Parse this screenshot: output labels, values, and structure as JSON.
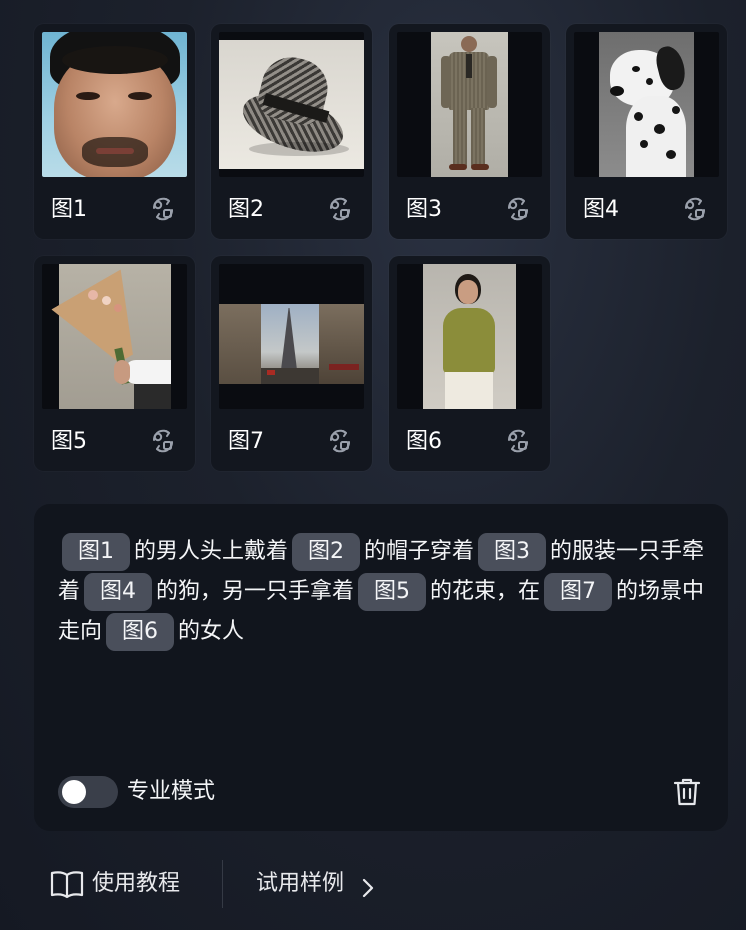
{
  "images": [
    {
      "label": "图1",
      "icon": "swap-icon"
    },
    {
      "label": "图2",
      "icon": "swap-icon"
    },
    {
      "label": "图3",
      "icon": "swap-icon"
    },
    {
      "label": "图4",
      "icon": "swap-icon"
    },
    {
      "label": "图5",
      "icon": "swap-icon"
    },
    {
      "label": "图7",
      "icon": "swap-icon"
    },
    {
      "label": "图6",
      "icon": "swap-icon"
    }
  ],
  "prompt": {
    "segments": [
      {
        "type": "tag",
        "text": "图1"
      },
      {
        "type": "text",
        "text": "的男人头上戴着"
      },
      {
        "type": "tag",
        "text": "图2"
      },
      {
        "type": "text",
        "text": "的帽子穿着"
      },
      {
        "type": "tag",
        "text": "图3"
      },
      {
        "type": "text",
        "text": "的服装一只手牵着"
      },
      {
        "type": "tag",
        "text": "图4"
      },
      {
        "type": "text",
        "text": "的狗，另一只手拿着"
      },
      {
        "type": "tag",
        "text": "图5"
      },
      {
        "type": "text",
        "text": "的花束，在"
      },
      {
        "type": "tag",
        "text": "图7"
      },
      {
        "type": "text",
        "text": "的场景中走向"
      },
      {
        "type": "tag",
        "text": "图6"
      },
      {
        "type": "text",
        "text": "的女人"
      }
    ],
    "pro_mode_label": "专业模式",
    "pro_mode_on": false
  },
  "footer": {
    "tutorial_label": "使用教程",
    "examples_label": "试用样例"
  },
  "colors": {
    "background": "#1c212c",
    "card": "#13171f",
    "tag": "#4a4f5b",
    "toggle_off": "#3a3f4a"
  }
}
